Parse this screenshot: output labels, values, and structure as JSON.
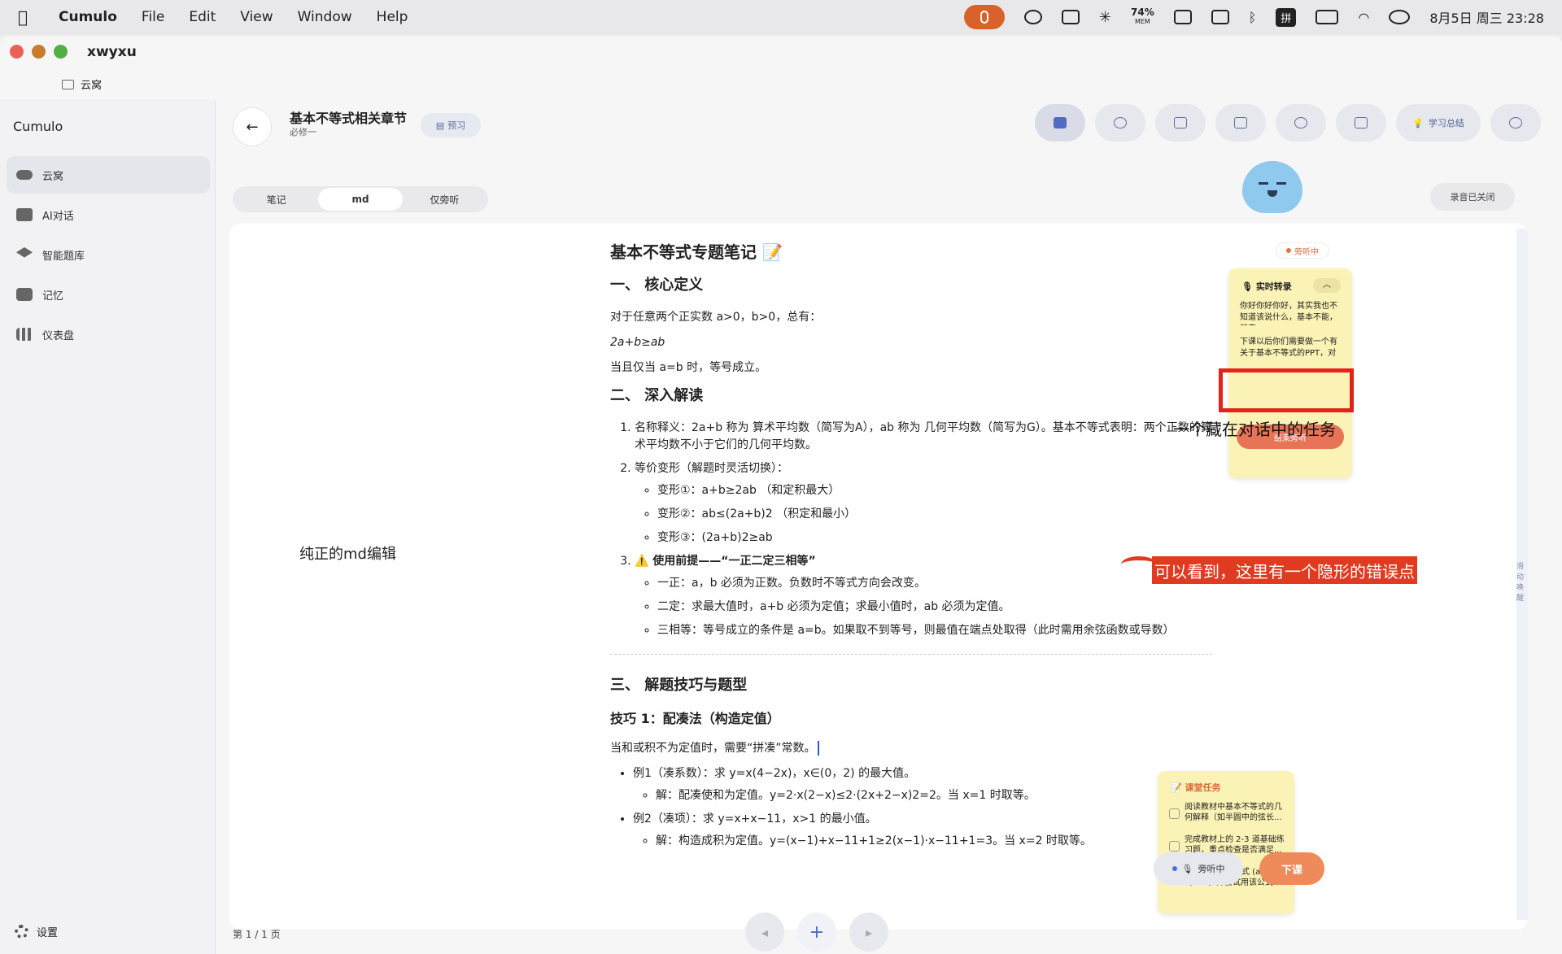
{
  "menubar": {
    "app": "Cumulo",
    "menus": [
      "File",
      "Edit",
      "View",
      "Window",
      "Help"
    ],
    "mem_percent": "74%",
    "mem_label": "MEM",
    "input_method": "拼",
    "clock": "8月5日 周三  23:28"
  },
  "window": {
    "title": "xwyxu",
    "breadcrumb": "云窝"
  },
  "sidebar": {
    "app_name": "Cumulo",
    "items": [
      {
        "label": "云窝",
        "icon": "cloud-icon"
      },
      {
        "label": "AI对话",
        "icon": "chat-icon"
      },
      {
        "label": "智能题库",
        "icon": "graduation-cap-icon"
      },
      {
        "label": "记忆",
        "icon": "archive-icon"
      },
      {
        "label": "仪表盘",
        "icon": "bar-chart-icon"
      }
    ],
    "settings": "设置"
  },
  "header": {
    "title": "基本不等式相关章节",
    "subtitle": "必修一",
    "preview": "预习",
    "summary": "学习总结"
  },
  "tabs": [
    "笔记",
    "md",
    "仅旁听"
  ],
  "recording_status": "录音已关闭",
  "editor_label": "纯正的md编辑",
  "doc": {
    "h1": "基本不等式专题笔记 📝",
    "s1_title": "一、 核心定义",
    "s1_p1": "对于任意两个正实数 a>0，b>0，总有：",
    "s1_formula": "2a+b≥ab",
    "s1_p2": "当且仅当 a=b 时，等号成立。",
    "s2_title": "二、 深入解读",
    "item1": "名称释义：2a+b 称为 算术平均数（简写为A），ab 称为 几何平均数（简写为G）。基本不等式表明：两个正数的算术平均数不小于它们的几何平均数。",
    "item2": "等价变形（解题时灵活切换）：",
    "item2_subs": [
      "变形①：a+b≥2ab  （和定积最大）",
      "变形②：ab≤(2a+b)2  （积定和最小）",
      "变形③：(2a+b)2≥ab"
    ],
    "item3": "⚠️ 使用前提——“一正二定三相等”",
    "item3_subs": [
      "一正：a，b 必须为正数。负数时不等式方向会改变。",
      "二定：求最大值时，a+b 必须为定值；求最小值时，ab 必须为定值。",
      "三相等：等号成立的条件是 a=b。如果取不到等号，则最值在端点处取得（此时需用余弦函数或导数）"
    ],
    "s3_title": "三、 解题技巧与题型",
    "tip1": "技巧 1：配凑法（构造定值）",
    "tip1_p": "当和或积不为定值时，需要“拼凑”常数。",
    "ex1": "例1（凑系数）：求 y=x(4−2x)，x∈(0，2) 的最大值。",
    "ex1_sol": "解：配凑使和为定值。y=2·x(2−x)≤2·(2x+2−x)2=2。当 x=1 时取等。",
    "ex2": "例2（凑项）：求 y=x+x−11，x>1 的最小值。",
    "ex2_sol": "解：构造成积为定值。y=(x−1)+x−11+1≥2(x−1)·x−11+1=3。当 x=2 时取等。"
  },
  "listening_badge": "旁听中",
  "transcript": {
    "title": "实时转录",
    "text1": "你好你好你好，其实我也不知道该说什么，基本不能，其实",
    "text2": "下课以后你们需要做一个有关于基本不等式的PPT，对就",
    "end_button": "结束旁听"
  },
  "annotations": {
    "task_hint": "一个藏在对话中的任务",
    "error_hint": "可以看到，这里有一个隐形的错误点"
  },
  "scroll_hint": "滑动唤醒",
  "class_tasks": {
    "title": "课堂任务",
    "items": [
      "阅读教材中基本不等式的几何解释（如半圆中的弦长...",
      "完成教材上的 2-3 道基础练习题，重点检查是否满足...",
      "复习完全平方公式 (a-b)²≥0，并尝试用该公式..."
    ]
  },
  "footer": {
    "page": "第 1 / 1 页",
    "listen": "旁听中",
    "end_class": "下课"
  },
  "colors": {
    "accent_orange": "#ef8a5a",
    "annotation_red": "#e03a20",
    "note_yellow": "#fbf3b5",
    "tool_blue": "#4f6cc2"
  }
}
